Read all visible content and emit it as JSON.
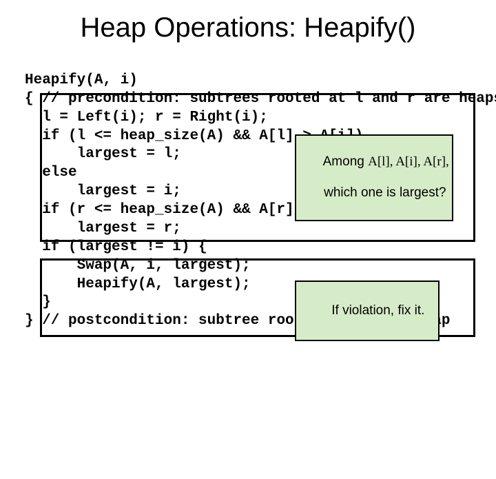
{
  "title": "Heap Operations: Heapify()",
  "code": {
    "l1": "Heapify(A, i)",
    "l2": "{ // precondition: subtrees rooted at l and r are heaps",
    "l3": "  l = Left(i); r = Right(i);",
    "l4": "  if (l <= heap_size(A) && A[l] > A[i])",
    "l5": "      largest = l;",
    "l6": "  else",
    "l7": "      largest = i;",
    "l8": "  if (r <= heap_size(A) && A[r] > A[largest])",
    "l9": "      largest = r;",
    "l10": "  if (largest != i) {",
    "l11": "      Swap(A, i, largest);",
    "l12": "      Heapify(A, largest);",
    "l13": "  }",
    "l14": "} // postcondition: subtree rooted at i is a heap"
  },
  "callout1": {
    "line1_prefix": "Among ",
    "line1_vars": "A[l], A[i], A[r],",
    "line2": "which one is largest?"
  },
  "callout2": "If violation, fix it."
}
